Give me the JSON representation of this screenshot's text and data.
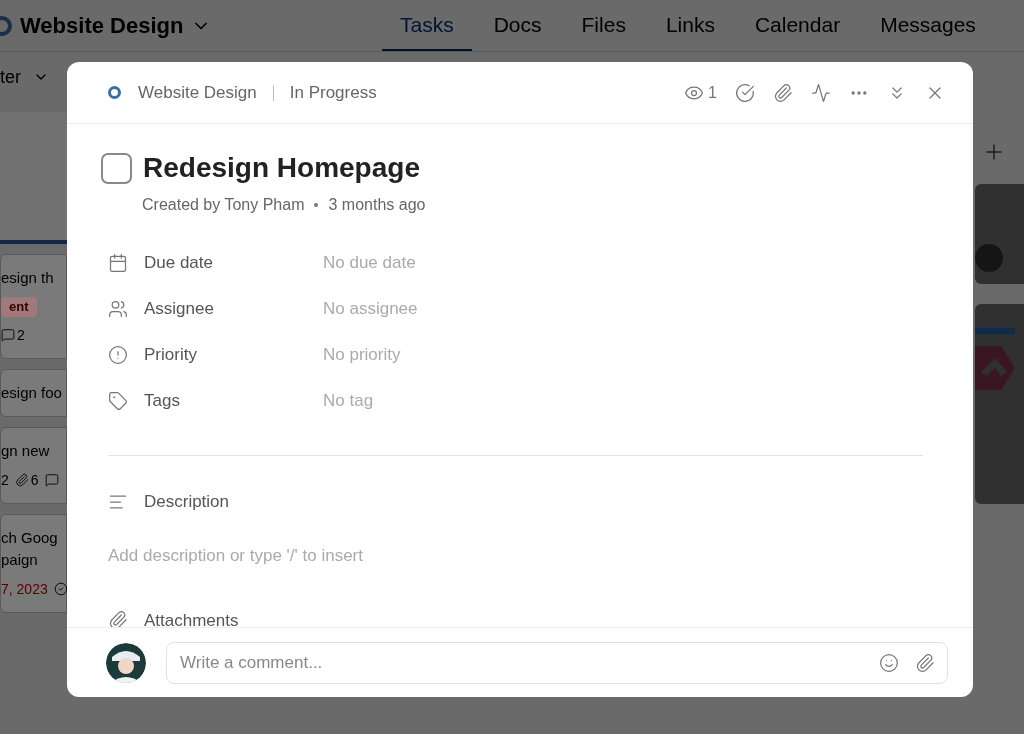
{
  "project": {
    "name": "Website Design"
  },
  "nav_tabs": [
    {
      "label": "Tasks",
      "selected": true
    },
    {
      "label": "Docs",
      "selected": false
    },
    {
      "label": "Files",
      "selected": false
    },
    {
      "label": "Links",
      "selected": false
    },
    {
      "label": "Calendar",
      "selected": false
    },
    {
      "label": "Messages",
      "selected": false
    }
  ],
  "filter": {
    "label": "ter"
  },
  "background_cards": [
    {
      "lines": [
        "esign th"
      ],
      "tag": "ent",
      "meta": [
        {
          "kind": "comments",
          "text": "2"
        }
      ]
    },
    {
      "lines": [
        "esign foo"
      ]
    },
    {
      "lines": [
        "gn new"
      ],
      "meta": [
        {
          "kind": "plain",
          "text": "2"
        },
        {
          "kind": "attachments",
          "text": "6"
        },
        {
          "kind": "comments"
        }
      ]
    },
    {
      "lines": [
        "ch Goog",
        "paign"
      ],
      "date": "7, 2023",
      "meta": [
        {
          "kind": "done"
        }
      ]
    }
  ],
  "modal": {
    "project": "Website Design",
    "status": "In Progress",
    "watchers": "1",
    "task": {
      "title": "Redesign Homepage",
      "completed": false,
      "created_by": "Created by Tony Pham",
      "created_ago": "3 months ago"
    },
    "fields": [
      {
        "kind": "date",
        "label": "Due date",
        "value": "No due date"
      },
      {
        "kind": "assignee",
        "label": "Assignee",
        "value": "No assignee"
      },
      {
        "kind": "priority",
        "label": "Priority",
        "value": "No priority"
      },
      {
        "kind": "tags",
        "label": "Tags",
        "value": "No tag"
      }
    ],
    "description": {
      "label": "Description",
      "placeholder": "Add description or type '/' to insert"
    },
    "attachments": {
      "label": "Attachments"
    },
    "comment": {
      "placeholder": "Write a comment..."
    }
  }
}
